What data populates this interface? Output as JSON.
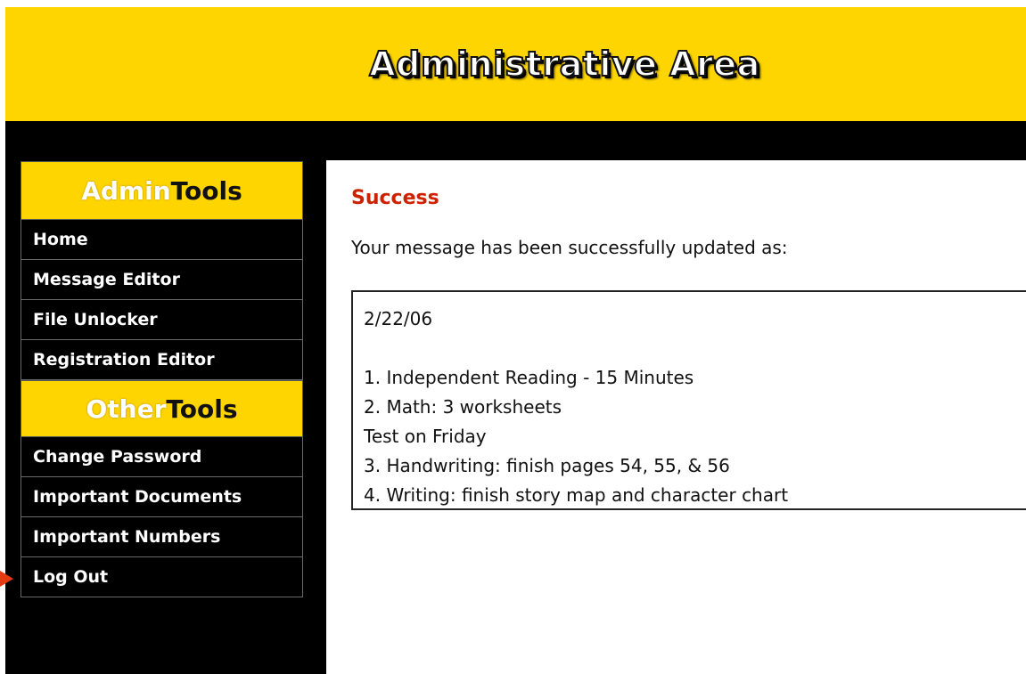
{
  "header": {
    "title": "Administrative Area"
  },
  "sidebar": {
    "admin_tools": {
      "heading_part1": "Admin",
      "heading_part2": "Tools",
      "items": [
        {
          "label": "Home"
        },
        {
          "label": "Message Editor"
        },
        {
          "label": "File Unlocker"
        },
        {
          "label": "Registration Editor"
        }
      ]
    },
    "other_tools": {
      "heading_part1": "Other",
      "heading_part2": "Tools",
      "items": [
        {
          "label": "Change Password"
        },
        {
          "label": "Important Documents"
        },
        {
          "label": "Important Numbers"
        },
        {
          "label": "Log Out"
        }
      ]
    }
  },
  "main": {
    "status_title": "Success",
    "status_message": "Your message has been successfully updated as:",
    "message_lines": [
      "2/22/06",
      "",
      "1. Independent Reading - 15 Minutes",
      "2. Math: 3 worksheets",
      "Test on Friday",
      "3. Handwriting: finish pages 54, 55, & 56",
      "4. Writing: finish story map and character chart"
    ]
  },
  "colors": {
    "header_yellow": "#FFD500",
    "success_red": "#CC2200",
    "pointer_red": "#E43A12"
  }
}
